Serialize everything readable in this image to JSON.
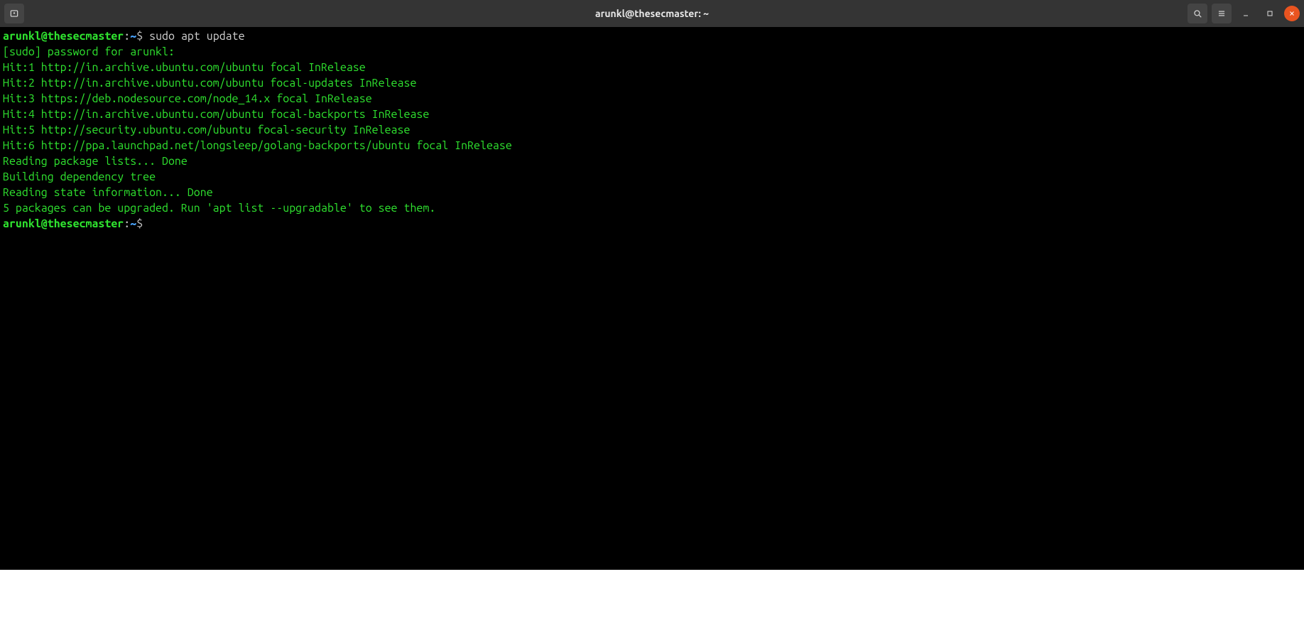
{
  "window": {
    "title": "arunkl@thesecmaster: ~"
  },
  "prompt": {
    "user": "arunkl",
    "at": "@",
    "host": "thesecmaster",
    "colon": ":",
    "path": "~",
    "dollar": "$"
  },
  "commands": {
    "c0": "sudo apt update"
  },
  "output": {
    "l0": "[sudo] password for arunkl:",
    "l1": "Hit:1 http://in.archive.ubuntu.com/ubuntu focal InRelease",
    "l2": "Hit:2 http://in.archive.ubuntu.com/ubuntu focal-updates InRelease",
    "l3": "Hit:3 https://deb.nodesource.com/node_14.x focal InRelease",
    "l4": "Hit:4 http://in.archive.ubuntu.com/ubuntu focal-backports InRelease",
    "l5": "Hit:5 http://security.ubuntu.com/ubuntu focal-security InRelease",
    "l6": "Hit:6 http://ppa.launchpad.net/longsleep/golang-backports/ubuntu focal InRelease",
    "l7": "Reading package lists... Done",
    "l8": "Building dependency tree",
    "l9": "Reading state information... Done",
    "l10": "5 packages can be upgraded. Run 'apt list --upgradable' to see them."
  }
}
